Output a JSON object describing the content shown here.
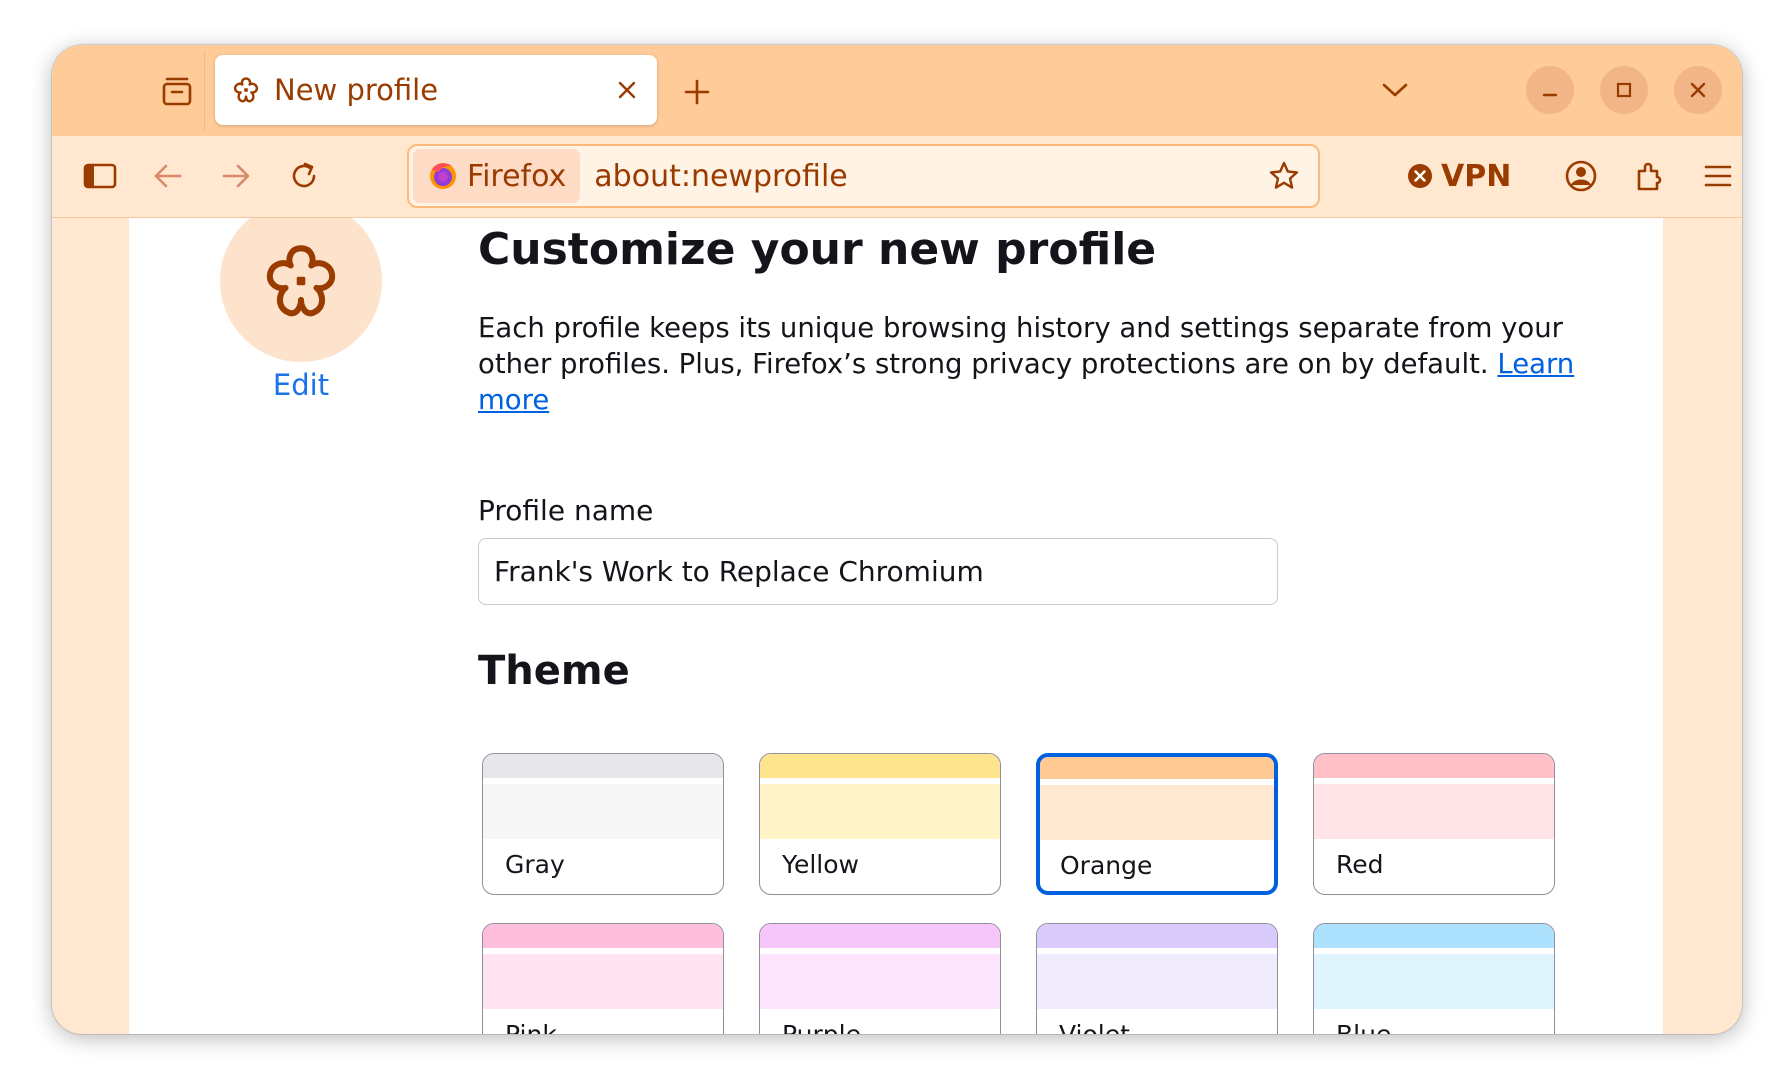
{
  "browser": {
    "tab_title": "New profile",
    "identity_label": "Firefox",
    "url": "about:newprofile",
    "vpn_label": "VPN"
  },
  "page": {
    "avatar_edit": "Edit",
    "heading": "Customize your new profile",
    "description": "Each profile keeps its unique browsing history and settings separate from your other profiles. Plus, Firefox’s strong privacy protections are on by default. ",
    "learn_more": "Learn more",
    "name_label": "Profile name",
    "name_value": "Frank's Work to Replace Chromium",
    "theme_heading": "Theme"
  },
  "themes": [
    {
      "label": "Gray",
      "frame": "#e7e7e9",
      "toolbar": "#f6f6f7",
      "selected": false
    },
    {
      "label": "Yellow",
      "frame": "#ffe48e",
      "toolbar": "#fff3c7",
      "selected": false
    },
    {
      "label": "Orange",
      "frame": "#ffc994",
      "toolbar": "#ffe8cf",
      "selected": true
    },
    {
      "label": "Red",
      "frame": "#ffc1c7",
      "toolbar": "#ffe3e6",
      "selected": false
    },
    {
      "label": "Pink",
      "frame": "#ffbedc",
      "toolbar": "#ffe3f0",
      "selected": false
    },
    {
      "label": "Purple",
      "frame": "#f6c6f8",
      "toolbar": "#fde6fd",
      "selected": false
    },
    {
      "label": "Violet",
      "frame": "#d9cbfb",
      "toolbar": "#f1ecfd",
      "selected": false
    },
    {
      "label": "Blue",
      "frame": "#ace2fe",
      "toolbar": "#e0f4fe",
      "selected": false
    }
  ],
  "colors": {
    "accent": "#9a3b00",
    "tab_strip": "#ffcb98",
    "toolbar": "#ffe8cf",
    "link": "#0061e0",
    "selection": "#0060df"
  },
  "icons": {
    "tab_overview": "tab-overview-icon",
    "favicon": "flower-icon",
    "tab_close": "close-icon",
    "new_tab": "plus-icon",
    "list_all_tabs": "chevron-down-icon",
    "minimize": "minimize-icon",
    "maximize": "maximize-icon",
    "close_window": "close-icon",
    "sidebar": "sidebar-icon",
    "back": "back-arrow-icon",
    "forward": "forward-arrow-icon",
    "reload": "reload-icon",
    "firefox_logo": "firefox-logo-icon",
    "bookmark": "star-icon",
    "vpn_status": "vpn-off-icon",
    "account": "account-icon",
    "extensions": "puzzle-icon",
    "menu": "hamburger-menu-icon",
    "avatar": "flower-icon"
  }
}
